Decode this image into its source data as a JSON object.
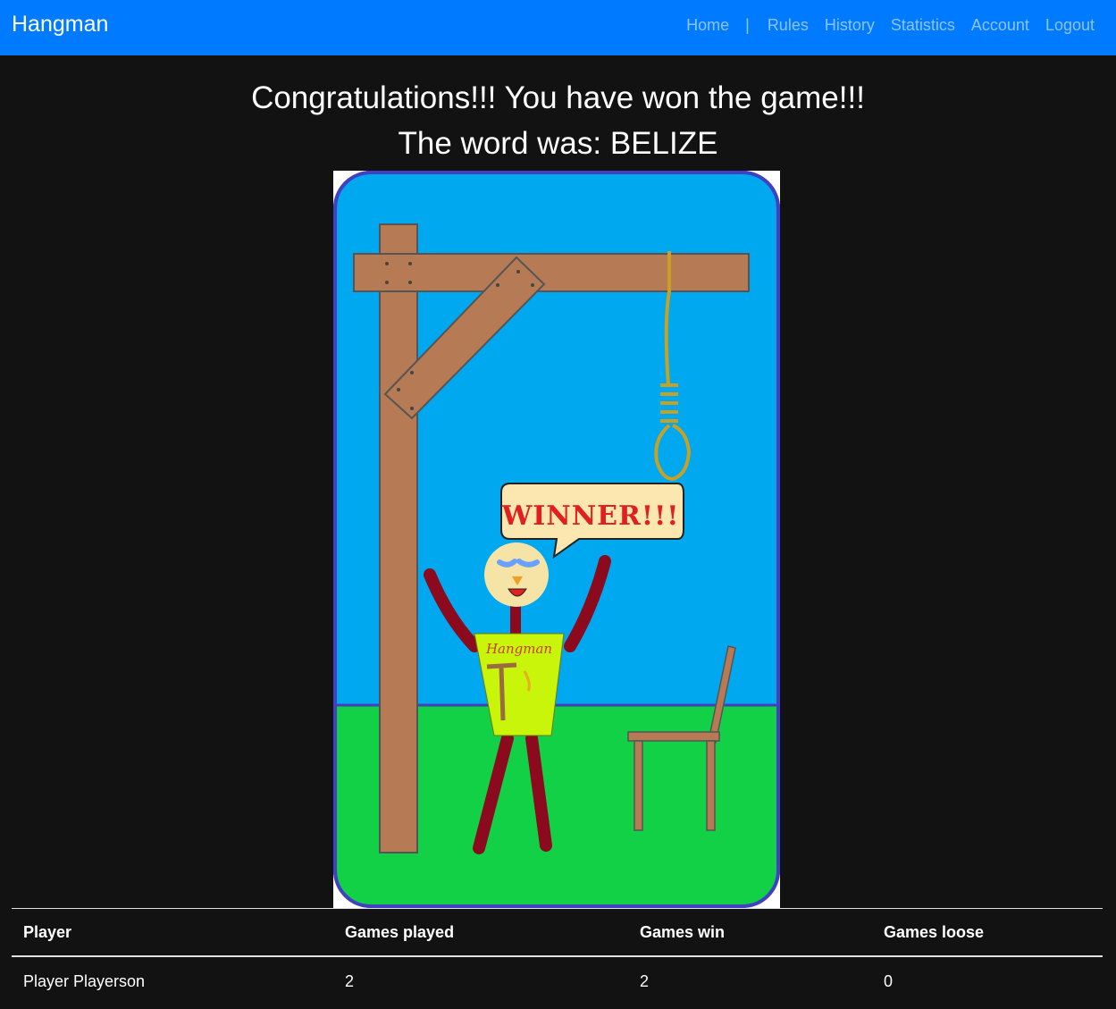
{
  "navbar": {
    "brand": "Hangman",
    "links": {
      "home": "Home",
      "separator": "|",
      "rules": "Rules",
      "history": "History",
      "statistics": "Statistics",
      "account": "Account",
      "logout": "Logout"
    },
    "background_color": "#007bff"
  },
  "result": {
    "message": "Congratulations!!! You have won the game!!!",
    "word_line": "The word was: BELIZE"
  },
  "illustration": {
    "speech_bubble": "WINNER!!!",
    "shirt_text": "Hangman",
    "sky_color": "#00a8f0",
    "grass_color": "#12d146",
    "frame_color": "#4040c0"
  },
  "stats_table": {
    "headers": [
      "Player",
      "Games played",
      "Games win",
      "Games loose"
    ],
    "rows": [
      [
        "Player Playerson",
        "2",
        "2",
        "0"
      ]
    ]
  }
}
